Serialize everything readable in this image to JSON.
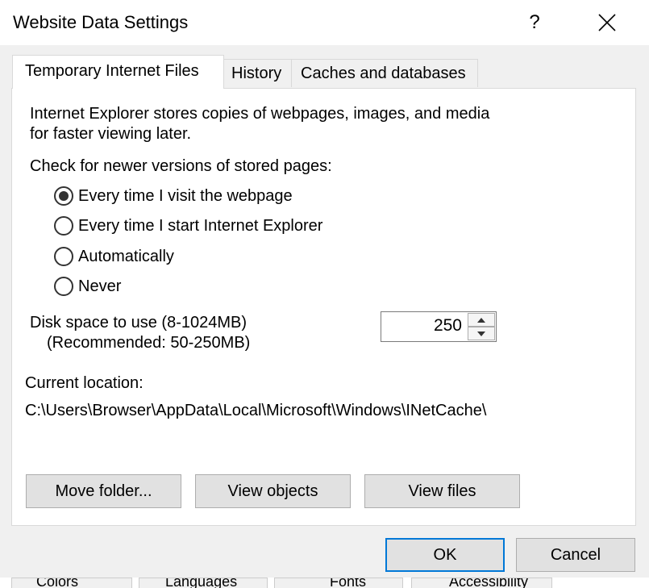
{
  "window": {
    "title": "Website Data Settings",
    "help_icon": "?",
    "close_icon": "close-icon"
  },
  "tabs": [
    {
      "label": "Temporary Internet Files",
      "active": true
    },
    {
      "label": "History",
      "active": false
    },
    {
      "label": "Caches and databases",
      "active": false
    }
  ],
  "content": {
    "description_line1": "Internet Explorer stores copies of webpages, images, and media",
    "description_line2": "for faster viewing later.",
    "check_label": "Check for newer versions of stored pages:",
    "radio_options": [
      {
        "label": "Every time I visit the webpage",
        "selected": true
      },
      {
        "label": "Every time I start Internet Explorer",
        "selected": false
      },
      {
        "label": "Automatically",
        "selected": false
      },
      {
        "label": "Never",
        "selected": false
      }
    ],
    "disk_label_line1": "Disk space to use (8-1024MB)",
    "disk_label_line2": "(Recommended: 50-250MB)",
    "disk_value": "250",
    "location_label": "Current location:",
    "location_path": "C:\\Users\\Browser\\AppData\\Local\\Microsoft\\Windows\\INetCache\\"
  },
  "actions": {
    "move_folder": "Move folder...",
    "view_objects": "View objects",
    "view_files": "View files"
  },
  "footer": {
    "ok": "OK",
    "cancel": "Cancel"
  },
  "background_tabs": [
    "Colors",
    "Languages",
    "Fonts",
    "Accessibility"
  ],
  "colors": {
    "accent": "#0078d7",
    "button_bg": "#e1e1e1",
    "dialog_bg": "#f0f0f0"
  }
}
